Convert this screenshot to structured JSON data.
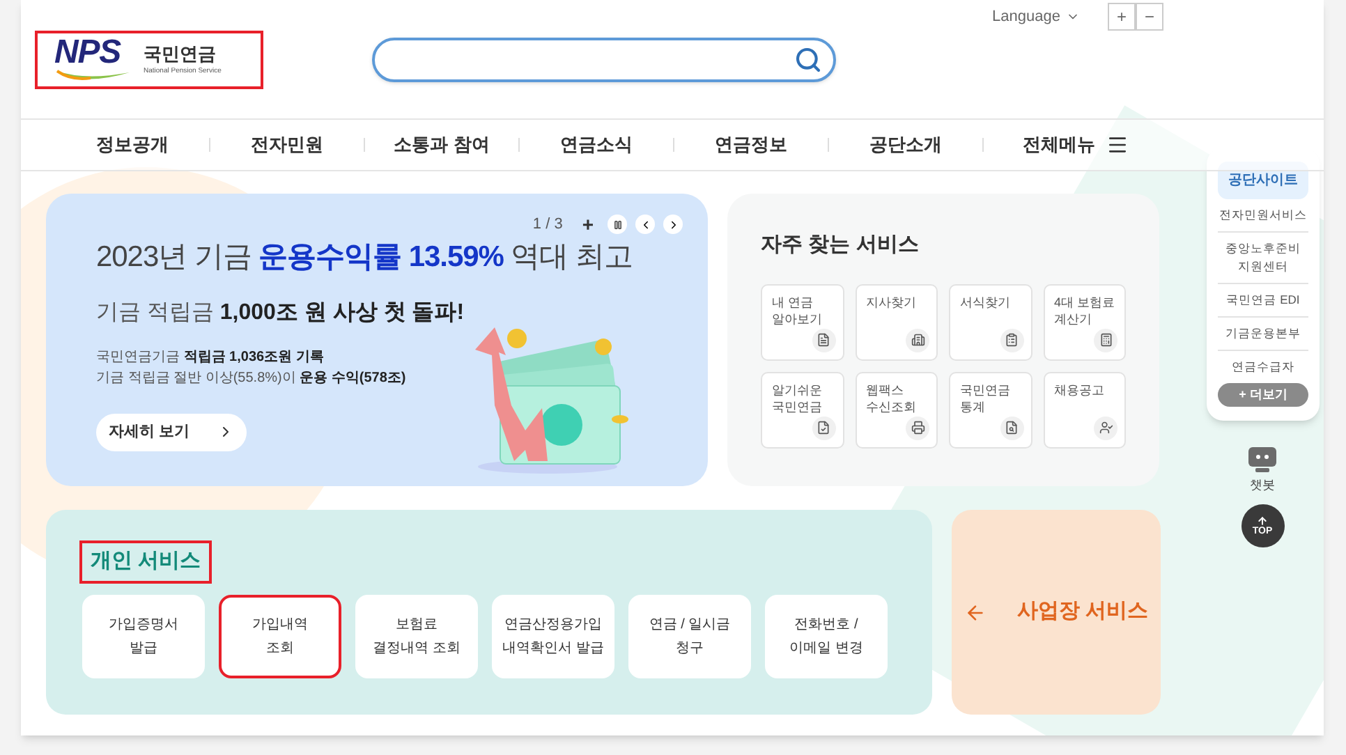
{
  "header": {
    "logo": {
      "mark": "NPS",
      "name": "국민연금",
      "subname": "National Pension Service",
      "highlighted": true
    },
    "language": "Language",
    "font_buttons": [
      "+",
      "−"
    ]
  },
  "nav": {
    "items": [
      "정보공개",
      "전자민원",
      "소통과 참여",
      "연금소식",
      "연금정보",
      "공단소개"
    ],
    "all_menu": "전체메뉴"
  },
  "banner": {
    "counter": "1 / 3",
    "plus": "+",
    "title_lead": "2023년 기금 ",
    "title_highlight": "운용수익률 13.59%",
    "title_tail": " 역대 최고",
    "subtitle": "기금 적립금 **1,000조 원 사상 첫 돌파!**",
    "lines": [
      "국민연금기금 **적립금 1,036조원 기록**",
      "기금 적립금 절반 이상(55.8%)이 **운용 수익(578조)**"
    ],
    "button": "자세히 보기"
  },
  "frequent": {
    "title": "자주 찾는 서비스",
    "items": [
      "내 연금\n알아보기",
      "지사찾기",
      "서식찾기",
      "4대 보험료\n계산기",
      "알기쉬운\n국민연금",
      "웹팩스\n수신조회",
      "국민연금\n통계",
      "채용공고"
    ]
  },
  "sidebar": {
    "header": "공단사이트",
    "items": [
      "전자민원서비스",
      "중앙노후준비\n지원센터",
      "국민연금 EDI",
      "기금운용본부",
      "연금수급자"
    ],
    "more": "+ 더보기",
    "chatbot": "챗봇",
    "top": "TOP"
  },
  "personal": {
    "title": "개인 서비스",
    "title_highlighted": true,
    "items": [
      {
        "label": "가입증명서\n발급",
        "highlighted": false
      },
      {
        "label": "가입내역\n조회",
        "highlighted": true
      },
      {
        "label": "보험료\n결정내역 조회",
        "highlighted": false
      },
      {
        "label": "연금산정용가입\n내역확인서 발급",
        "highlighted": false
      },
      {
        "label": "연금 / 일시금\n청구",
        "highlighted": false
      },
      {
        "label": "전화번호 /\n이메일 변경",
        "highlighted": false
      }
    ]
  },
  "business": {
    "title": "사업장 서비스"
  }
}
